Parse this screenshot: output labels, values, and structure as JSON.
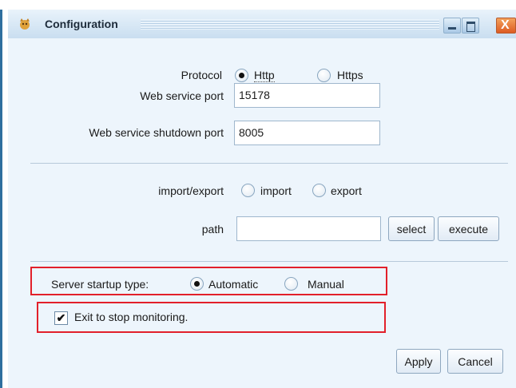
{
  "window": {
    "title": "Configuration",
    "icons": {
      "app": "settings-cat-icon",
      "minimize": "minimize-icon",
      "maximize": "maximize-icon",
      "close": "close-icon"
    },
    "close_glyph": "X"
  },
  "protocol": {
    "label": "Protocol",
    "options": [
      "Http",
      "Https"
    ],
    "selected": "Http"
  },
  "web_service_port": {
    "label": "Web service port",
    "value": "15178"
  },
  "shutdown_port": {
    "label": "Web service shutdown port",
    "value": "8005"
  },
  "import_export": {
    "label": "import/export",
    "options": [
      "import",
      "export"
    ],
    "selected": null
  },
  "path": {
    "label": "path",
    "value": "",
    "select_label": "select",
    "execute_label": "execute"
  },
  "startup": {
    "label": "Server startup type:",
    "options": [
      "Automatic",
      "Manual"
    ],
    "selected": "Automatic"
  },
  "exit_stop": {
    "label": "Exit to stop monitoring.",
    "checked": true,
    "check_glyph": "✔"
  },
  "footer": {
    "apply_label": "Apply",
    "cancel_label": "Cancel"
  },
  "colors": {
    "highlight_box": "#e2202a",
    "panel_bg": "#edf5fc",
    "titlebar": "#c9def0"
  }
}
